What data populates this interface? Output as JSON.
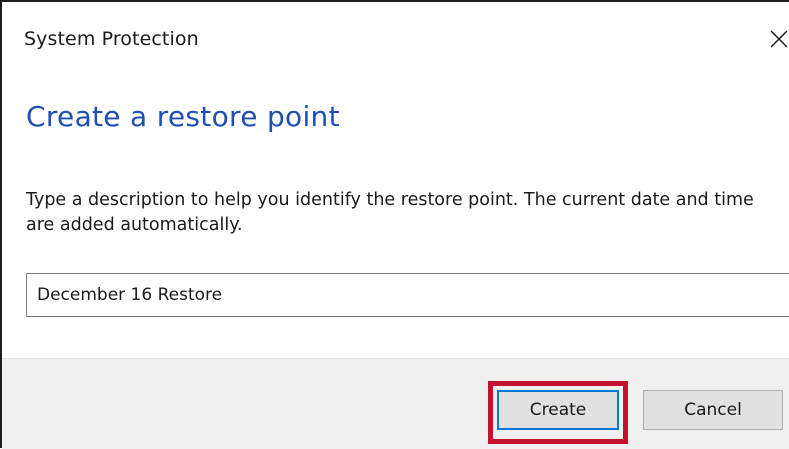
{
  "window": {
    "title": "System Protection",
    "close_icon": "close-icon"
  },
  "content": {
    "heading": "Create a restore point",
    "description": "Type a description to help you identify the restore point. The current date and time are added automatically.",
    "description_input_value": "December 16 Restore"
  },
  "footer": {
    "create_label": "Create",
    "cancel_label": "Cancel"
  },
  "colors": {
    "heading": "#1f4fb5",
    "highlight": "#c2102e",
    "footer_bg": "#f0f0f0",
    "focus_border": "#0078d7"
  }
}
